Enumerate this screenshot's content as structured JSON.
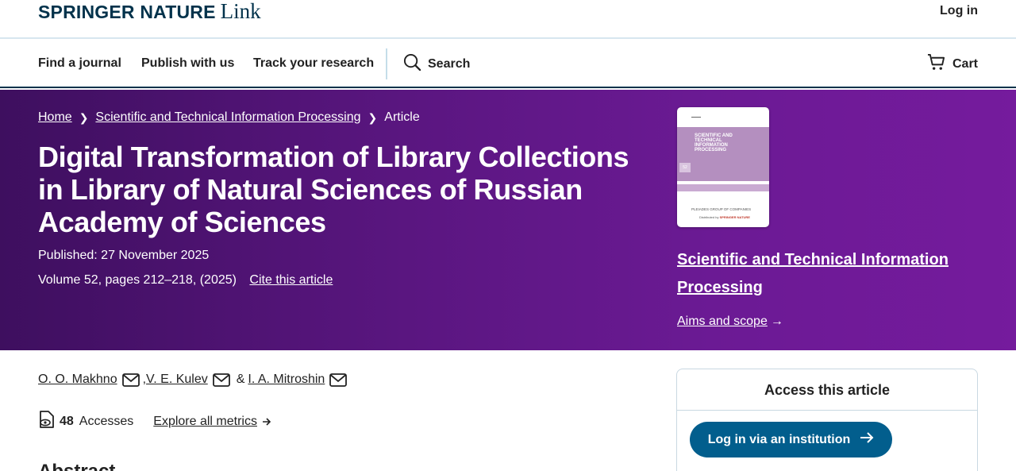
{
  "header": {
    "brand": "SPRINGER NATURE",
    "brand_suffix": "Link",
    "login_label": "Log in"
  },
  "nav": {
    "find_journal": "Find a journal",
    "publish": "Publish with us",
    "track": "Track your research",
    "search": "Search",
    "cart": "Cart"
  },
  "breadcrumb": {
    "home": "Home",
    "journal": "Scientific and Technical Information Processing",
    "current": "Article"
  },
  "article": {
    "title": "Digital Transformation of Library Collections in Library of Natural Sciences of Russian Academy of Sciences",
    "published": "Published: 27 November 2025",
    "volume": "Volume 52, pages 212–218, (2025)",
    "cite_label": "Cite this article",
    "authors": [
      "O. O. Makhno",
      "V. E. Kulev",
      "I. A. Mitroshin"
    ],
    "author_sep": ",",
    "author_amp": "&",
    "accesses_count": "48",
    "accesses_label": "Accesses",
    "explore_metrics": "Explore all metrics",
    "abstract_heading": "Abstract"
  },
  "journal": {
    "name": "Scientific and Technical Information Processing",
    "aims_label": "Aims and scope",
    "cover_title": "SCIENTIFIC AND TECHNICAL INFORMATION PROCESSING",
    "cover_publisher": "PLEIADES GROUP OF COMPANIES",
    "cover_distributed": "Distributed by",
    "cover_distributor": "SPRINGER NATURE",
    "cover_volume": "52"
  },
  "access": {
    "heading": "Access this article",
    "login_institution": "Log in via an institution"
  },
  "colors": {
    "brand_navy": "#01324b",
    "hero_purple": "#5a1680",
    "button_blue": "#025e8d"
  }
}
